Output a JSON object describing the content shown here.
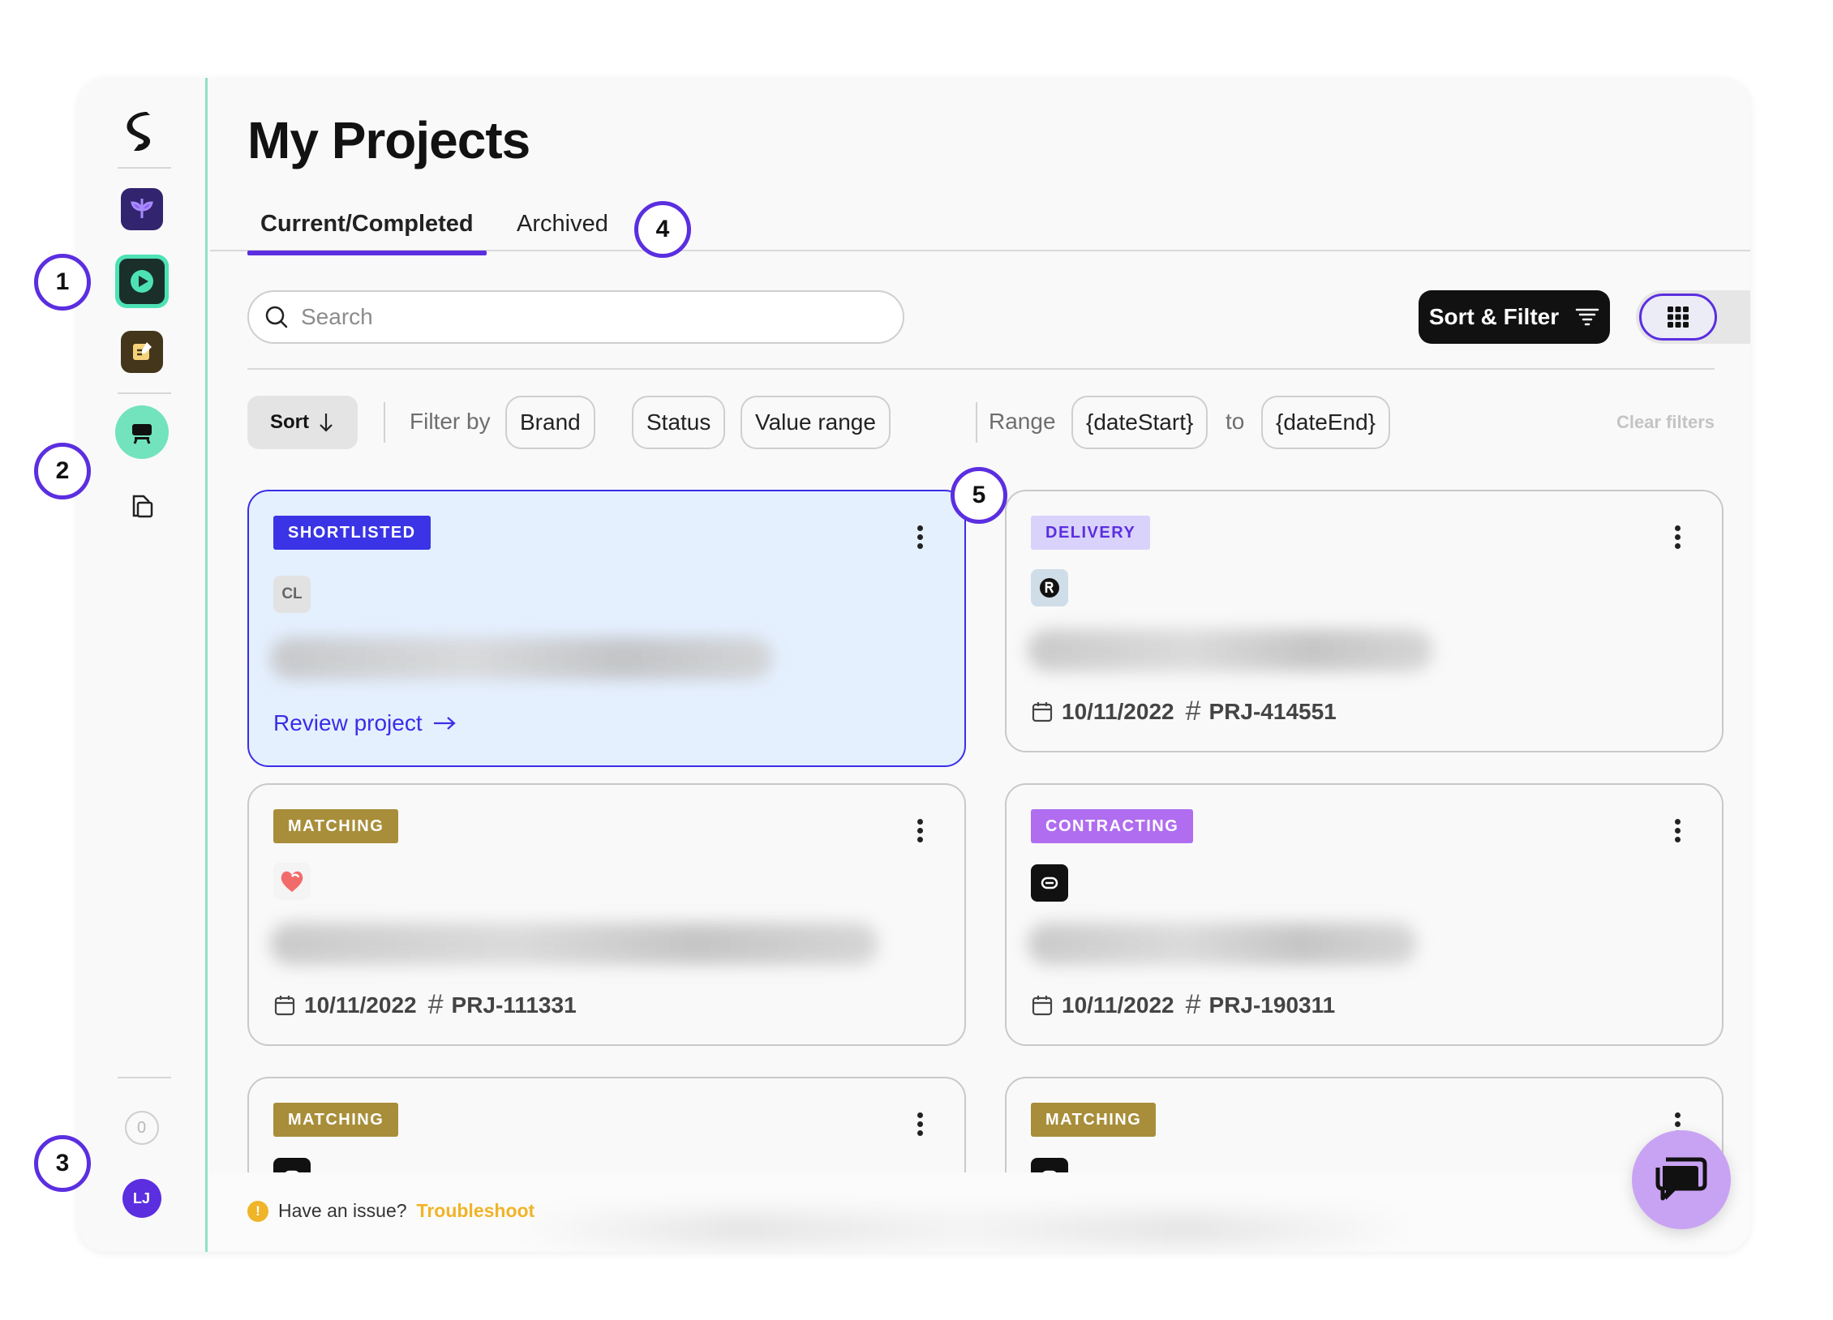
{
  "page": {
    "title": "My Projects"
  },
  "tabs": [
    {
      "label": "Current/Completed",
      "active": true
    },
    {
      "label": "Archived",
      "active": false
    }
  ],
  "search": {
    "placeholder": "Search",
    "value": ""
  },
  "toolbar": {
    "sort_filter_label": "Sort & Filter",
    "view_mode": "grid"
  },
  "filters": {
    "sort_label": "Sort",
    "filter_by_label": "Filter by",
    "chips": [
      "Brand",
      "Status",
      "Value range"
    ],
    "range_label": "Range",
    "date_start": "{dateStart}",
    "to_label": "to",
    "date_end": "{dateEnd}",
    "clear_label": "Clear filters"
  },
  "sidebar": {
    "notification_count": "0",
    "avatar_initials": "LJ"
  },
  "cards": [
    {
      "status": "SHORTLISTED",
      "brand": "CL",
      "action": "Review project",
      "highlighted": true
    },
    {
      "status": "DELIVERY",
      "date": "10/11/2022",
      "project_id": "PRJ-414551"
    },
    {
      "status": "MATCHING",
      "date": "10/11/2022",
      "project_id": "PRJ-111331"
    },
    {
      "status": "CONTRACTING",
      "date": "10/11/2022",
      "project_id": "PRJ-190311"
    },
    {
      "status": "MATCHING"
    },
    {
      "status": "MATCHING"
    }
  ],
  "footer": {
    "issue_text": "Have an issue?",
    "troubleshoot_label": "Troubleshoot"
  },
  "steps": [
    "1",
    "2",
    "3",
    "4",
    "5"
  ],
  "colors": {
    "accent": "#5b2ee0",
    "rail_border": "#8ee2c6",
    "shortlisted": "#3a34e6",
    "delivery_bg": "#d9d2fb",
    "matching": "#a88e3a",
    "contracting": "#b06df0",
    "troubleshoot": "#f0b429",
    "chat_button": "#c9a3f3"
  },
  "icons": [
    "logo-icon",
    "app-sprout-icon",
    "app-play-icon",
    "app-notes-icon",
    "studio-icon",
    "documents-icon",
    "search-icon",
    "filter-lines-icon",
    "grid-view-icon",
    "list-view-icon",
    "arrow-down-icon",
    "kebab-menu-icon",
    "calendar-icon",
    "hash-icon",
    "arrow-right-icon",
    "warning-icon",
    "chat-icon"
  ]
}
